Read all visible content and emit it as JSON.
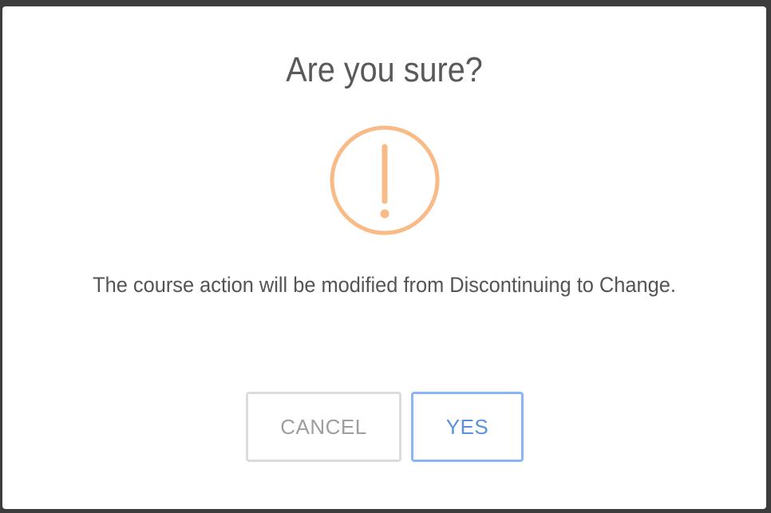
{
  "dialog": {
    "title": "Are you sure?",
    "icon": "warning-exclamation-icon",
    "message": "The course action will be modified from Discontinuing to Change.",
    "cancel_label": "CANCEL",
    "confirm_label": "YES"
  },
  "colors": {
    "warning": "#f8bb86",
    "cancel_border": "#dcdcdc",
    "cancel_text": "#9e9e9e",
    "confirm_border": "#8ab4f4",
    "confirm_text": "#5b8fe0",
    "backdrop": "#3c3c3c"
  }
}
